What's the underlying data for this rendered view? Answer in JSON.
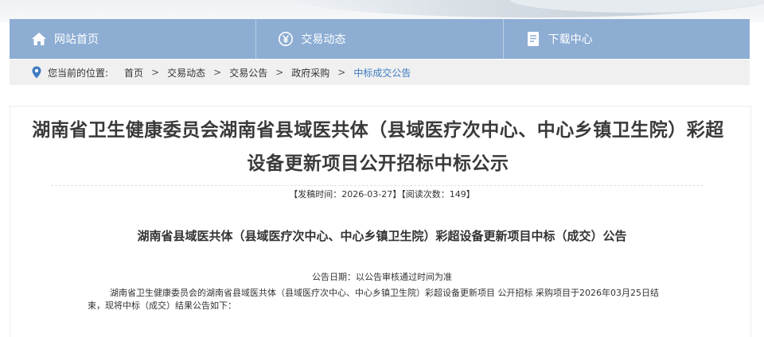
{
  "nav": {
    "items": [
      {
        "label": "网站首页",
        "icon": "home-icon"
      },
      {
        "label": "交易动态",
        "icon": "yen-icon"
      },
      {
        "label": "下载中心",
        "icon": "document-icon"
      }
    ]
  },
  "breadcrumb": {
    "label": "您当前的位置:",
    "items": [
      "首页",
      "交易动态",
      "交易公告",
      "政府采购"
    ],
    "separator": ">",
    "current": "中标成交公告"
  },
  "article": {
    "title": "湖南省卫生健康委员会湖南省县域医共体（县域医疗次中心、中心乡镇卫生院）彩超设备更新项目公开招标中标公示",
    "meta": "【发稿时间：2026-03-27】【阅读次数：149】",
    "subtitle": "湖南省县域医共体（县域医疗次中心、中心乡镇卫生院）彩超设备更新项目中标（成交）公告",
    "date": "公告日期：以公告审核通过时间为准",
    "paragraph": "湖南省卫生健康委员会的湖南省县域医共体（县域医疗次中心、中心乡镇卫生院）彩超设备更新项目 公开招标 采购项目于2026年03月25日结束，现将中标（成交）结果公告如下："
  },
  "colors": {
    "nav_bg": "#8dadd3",
    "breadcrumb_bg": "#f0f0f0",
    "accent_link": "#3d7bc2"
  }
}
